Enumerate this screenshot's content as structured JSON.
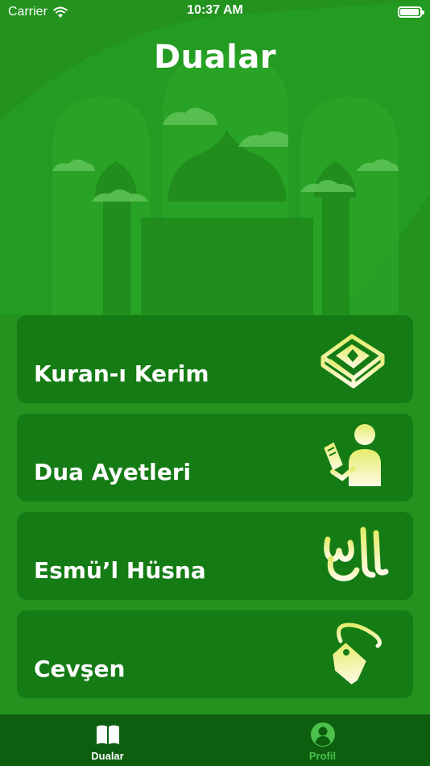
{
  "status_bar": {
    "carrier": "Carrier",
    "time": "10:37 AM"
  },
  "header": {
    "title": "Dualar"
  },
  "menu": {
    "items": [
      {
        "label": "Kuran-ı Kerim",
        "icon": "quran-book-icon"
      },
      {
        "label": "Dua Ayetleri",
        "icon": "reading-person-icon"
      },
      {
        "label": "Esmü’l Hüsna",
        "icon": "calligraphy-icon"
      },
      {
        "label": "Cevşen",
        "icon": "tag-icon"
      }
    ]
  },
  "tab_bar": {
    "tabs": [
      {
        "label": "Dualar",
        "icon": "book-icon",
        "active": true
      },
      {
        "label": "Profil",
        "icon": "profile-icon",
        "active": false
      }
    ]
  },
  "colors": {
    "background": "#23921f",
    "card": "#147b15",
    "tab_bar": "#0d5e0e",
    "icon_gradient_top": "#e9f07a",
    "icon_gradient_bottom": "#fffbe0",
    "inactive_tab": "#4bc14b"
  }
}
